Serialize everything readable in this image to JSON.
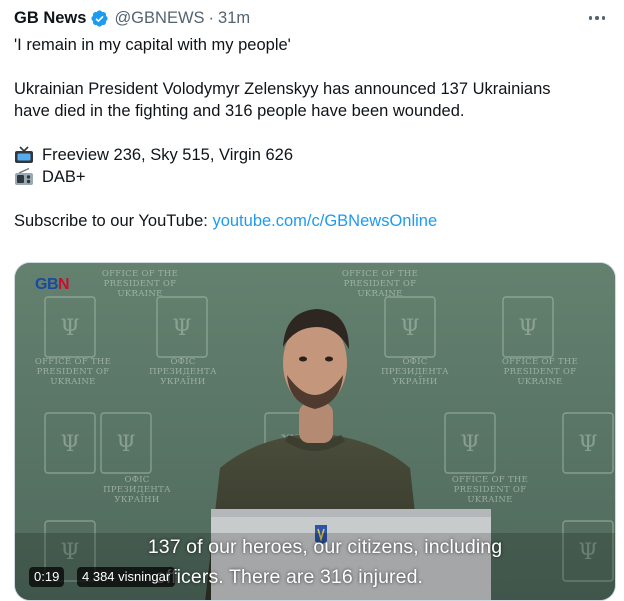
{
  "tweet": {
    "author_name": "GB News",
    "handle": "@GBNEWS",
    "separator": "·",
    "time": "31m",
    "line1": "'I remain in my capital with my people'",
    "line2": "Ukrainian President Volodymyr Zelenskyy has announced 137 Ukrainians",
    "line3": "have died in the fighting and 316 people have been wounded.",
    "tv_line": "Freeview 236, Sky 515, Virgin 626",
    "radio_line": "DAB+",
    "subscribe_prefix": "Subscribe to our YouTube: ",
    "subscribe_link": "youtube.com/c/GBNewsOnline",
    "link_color": "#1d9bf0",
    "verified_color": "#1d9bf0"
  },
  "media": {
    "channel_logo": "GBN",
    "wall_text_en": "OFFICE OF THE PRESIDENT OF UKRAINE",
    "wall_text_ua": "ОФІС ПРЕЗИДЕНТА УКРАЇНИ",
    "caption_line1": "137 of our heroes, our citizens, including",
    "caption_line2": "officers. There are 316 injured.",
    "elapsed": "0:19",
    "views": "4 384 visningar"
  }
}
